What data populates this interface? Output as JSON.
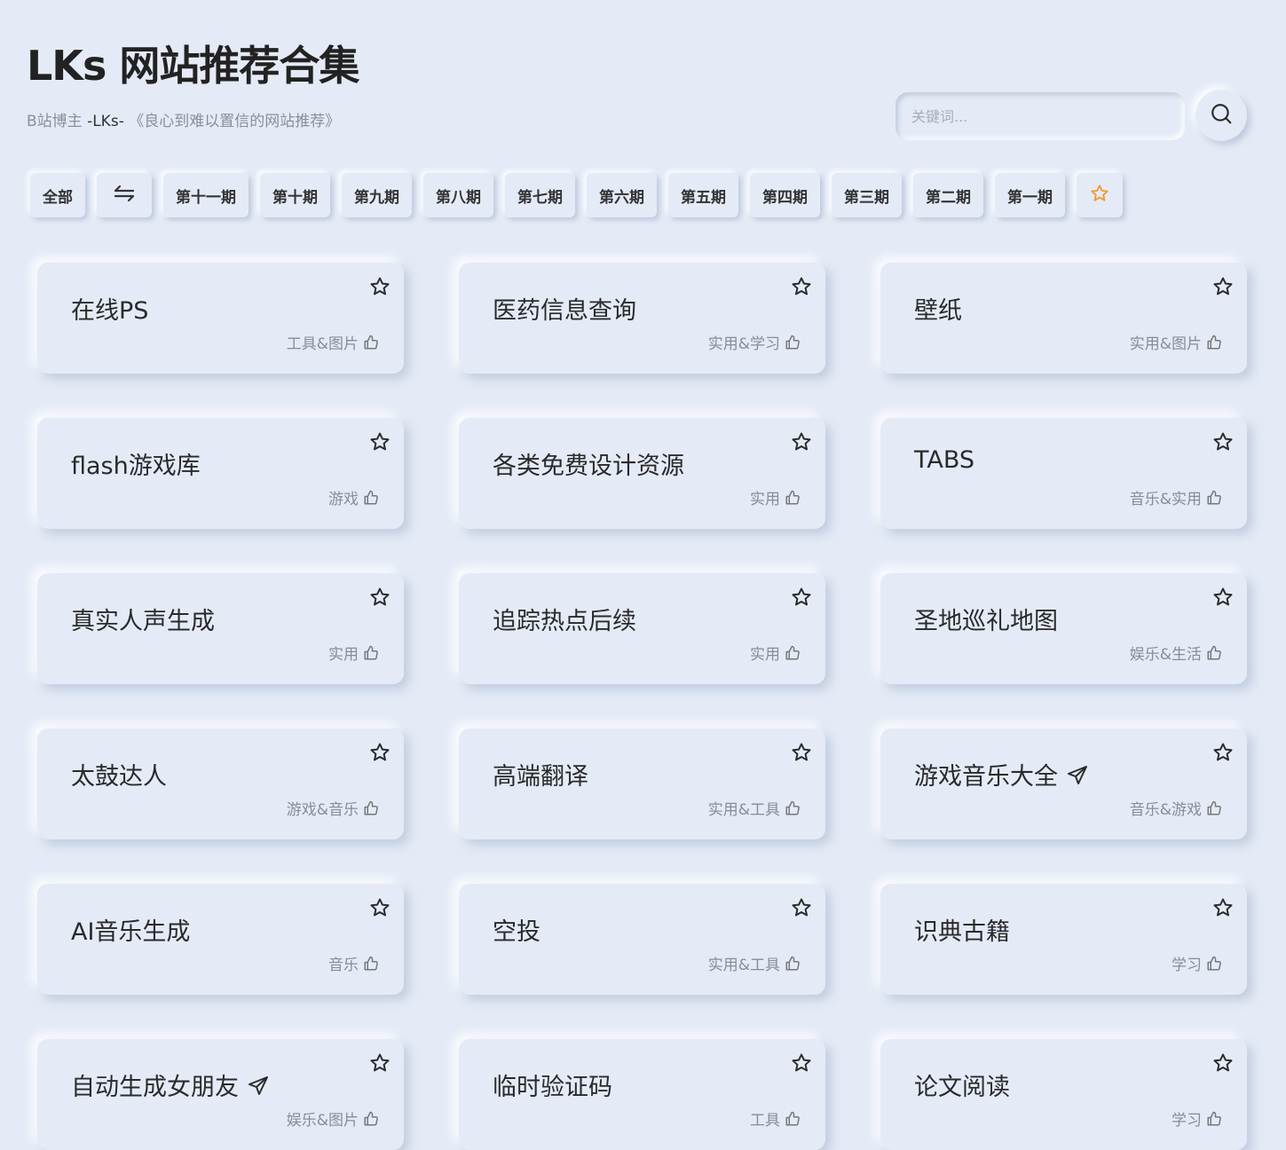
{
  "header": {
    "title": "LKs 网站推荐合集",
    "subtitle_prefix": "B站博主 ",
    "subtitle_author": "-LKs-",
    "subtitle_suffix": " 《良心到难以置信的网站推荐》"
  },
  "search": {
    "placeholder": "关键词..."
  },
  "tabs": [
    {
      "label": "全部"
    },
    {
      "label": "",
      "icon": "swap-arrows-icon"
    },
    {
      "label": "第十一期"
    },
    {
      "label": "第十期"
    },
    {
      "label": "第九期"
    },
    {
      "label": "第八期"
    },
    {
      "label": "第七期"
    },
    {
      "label": "第六期"
    },
    {
      "label": "第五期"
    },
    {
      "label": "第四期"
    },
    {
      "label": "第三期"
    },
    {
      "label": "第二期"
    },
    {
      "label": "第一期"
    },
    {
      "label": "",
      "icon": "star-icon"
    }
  ],
  "colors": {
    "background": "#e4ebf7",
    "accent_star": "#f29a2e",
    "text_dark": "#2a2a2a",
    "text_muted": "#888c94"
  },
  "cards": [
    {
      "title": "在线PS",
      "tags": "工具&图片"
    },
    {
      "title": "医药信息查询",
      "tags": "实用&学习"
    },
    {
      "title": "壁纸",
      "tags": "实用&图片"
    },
    {
      "title": "flash游戏库",
      "tags": "游戏"
    },
    {
      "title": "各类免费设计资源",
      "tags": "实用"
    },
    {
      "title": "TABS",
      "tags": "音乐&实用"
    },
    {
      "title": "真实人声生成",
      "tags": "实用"
    },
    {
      "title": "追踪热点后续",
      "tags": "实用"
    },
    {
      "title": "圣地巡礼地图",
      "tags": "娱乐&生活"
    },
    {
      "title": "太鼓达人",
      "tags": "游戏&音乐"
    },
    {
      "title": "高端翻译",
      "tags": "实用&工具"
    },
    {
      "title": "游戏音乐大全",
      "tags": "音乐&游戏",
      "badge": "send-icon"
    },
    {
      "title": "AI音乐生成",
      "tags": "音乐"
    },
    {
      "title": "空投",
      "tags": "实用&工具"
    },
    {
      "title": "识典古籍",
      "tags": "学习"
    },
    {
      "title": "自动生成女朋友",
      "tags": "娱乐&图片",
      "badge": "send-icon"
    },
    {
      "title": "临时验证码",
      "tags": "工具"
    },
    {
      "title": "论文阅读",
      "tags": "学习"
    }
  ]
}
